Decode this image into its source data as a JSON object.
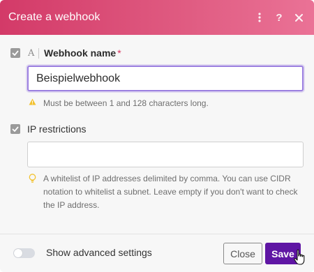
{
  "dialog": {
    "title": "Create a webhook",
    "header_icons": [
      "kebab-menu-icon",
      "help-icon",
      "close-icon"
    ],
    "accent_color": "#5f16a4",
    "header_color": "#d33a68"
  },
  "fields": {
    "webhook_name": {
      "label": "Webhook name",
      "required_mark": "*",
      "value": "Beispielwebhook",
      "hint": "Must be between 1 and 128 characters long.",
      "type_icon": "A"
    },
    "ip_restrictions": {
      "label": "IP restrictions",
      "value": "",
      "hint": "A whitelist of IP addresses delimited by comma. You can use CIDR notation to whitelist a subnet. Leave empty if you don't want to check the IP address."
    }
  },
  "footer": {
    "toggle_label": "Show advanced settings",
    "toggle_on": false,
    "close_label": "Close",
    "save_label": "Save"
  }
}
